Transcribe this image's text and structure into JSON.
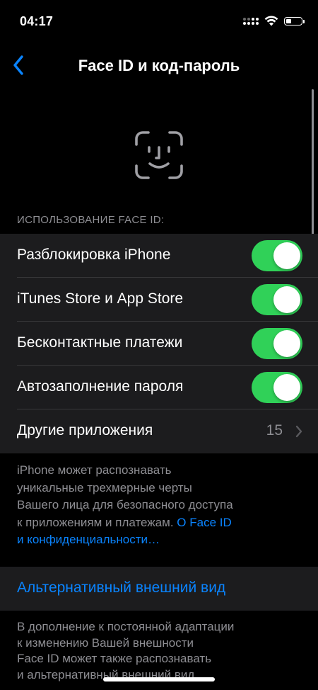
{
  "status_bar": {
    "time": "04:17",
    "icons": [
      "cellular-signal-icon",
      "wifi-icon",
      "battery-icon"
    ]
  },
  "nav": {
    "back_icon": "chevron-left-icon",
    "title": "Face ID и код-пароль"
  },
  "header_icon": "face-id-icon",
  "section": {
    "header": "ИСПОЛЬЗОВАНИЕ FACE ID:",
    "rows": [
      {
        "label": "Разблокировка iPhone",
        "toggle_on": true
      },
      {
        "label": "iTunes Store и App Store",
        "toggle_on": true
      },
      {
        "label": "Бесконтактные платежи",
        "toggle_on": true
      },
      {
        "label": "Автозаполнение пароля",
        "toggle_on": true
      },
      {
        "label": "Другие приложения",
        "count": "15"
      }
    ],
    "footer_lines": [
      "iPhone может распознавать",
      "уникальные трехмерные черты",
      "Вашего лица для безопасного доступа",
      "к приложениям и платежам."
    ],
    "footer_link_part1": "О Face ID",
    "footer_link_part2": "и конфиденциальности…"
  },
  "alternate": {
    "label": "Альтернативный внешний вид",
    "footer_lines": [
      "В дополнение к постоянной адаптации",
      "к изменению Вашей внешности",
      "Face ID может также распознавать",
      "и альтернативный внешний вид."
    ]
  },
  "colors": {
    "background": "#000000",
    "cell_background": "#1c1c1e",
    "toggle_on": "#30d158",
    "link": "#0a84ff",
    "secondary_text": "#8e8e93"
  }
}
